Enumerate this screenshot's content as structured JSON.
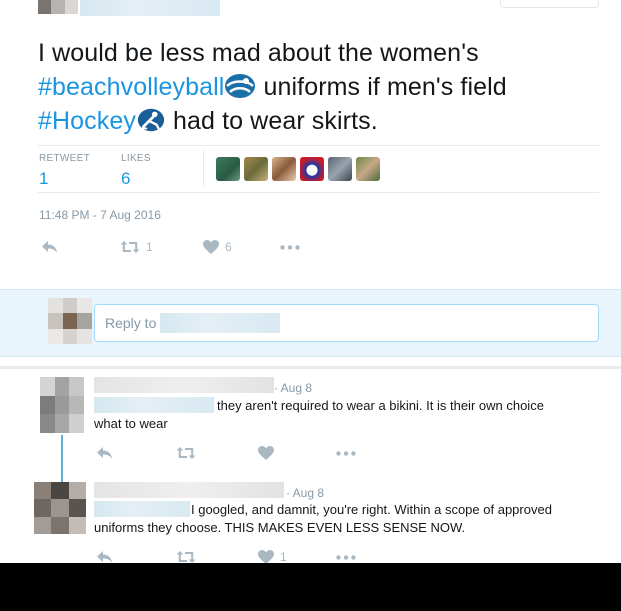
{
  "tweet": {
    "text_part1": "I would be less mad about the women's ",
    "hashtag1": "#beachvolleyball",
    "text_part2": " uniforms if men's field ",
    "hashtag2": "#Hockey",
    "text_part3": " had to wear skirts.",
    "hashflag1_icon": "volleyball-icon",
    "hashflag2_icon": "hockey-icon"
  },
  "stats": {
    "retweet_label": "RETWEET",
    "retweet_count": "1",
    "likes_label": "LIKES",
    "likes_count": "6"
  },
  "timestamp": "11:48 PM - 7 Aug 2016",
  "actions": {
    "retweet_count": "1",
    "like_count": "6"
  },
  "reply_box": {
    "placeholder": "Reply to"
  },
  "replies": [
    {
      "date": "· Aug 8",
      "text_line1": "they aren't required to wear a bikini. It is their own choice",
      "text_line2": "what to wear"
    },
    {
      "date": "· Aug 8",
      "text_line1": "I googled, and damnit, you're right. Within a scope of approved",
      "text_line2": "uniforms they choose. THIS MAKES EVEN LESS SENSE  NOW.",
      "like_count": "1"
    }
  ],
  "colors": {
    "link": "#1b95e0",
    "muted": "#8899a6",
    "icon": "#aab8c2",
    "reply_bar_bg": "#e8f5fd",
    "thread_line": "#5fb0d2"
  }
}
